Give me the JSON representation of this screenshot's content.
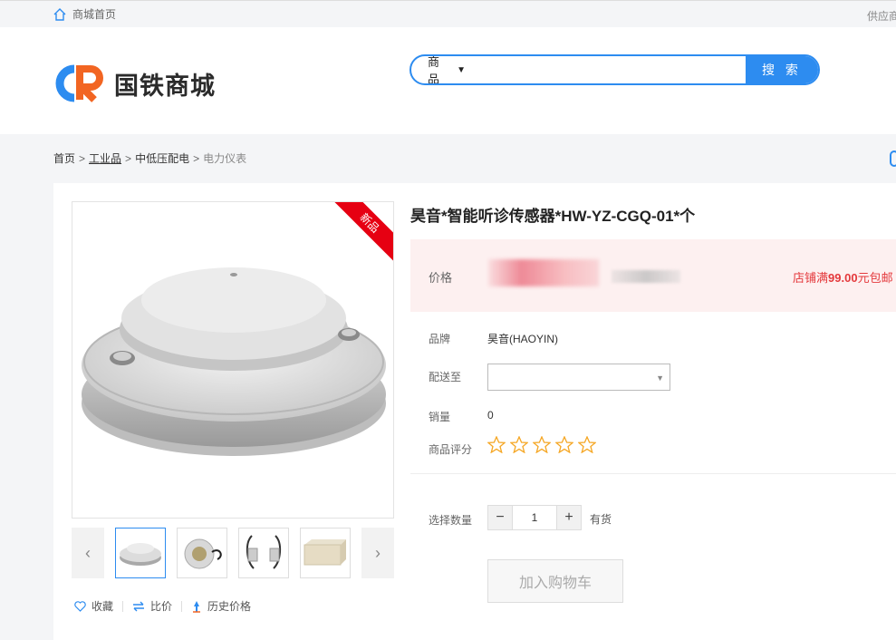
{
  "topbar": {
    "home_label": "商城首页",
    "right_label": "供应商"
  },
  "header": {
    "logo_text": "国铁商城",
    "search": {
      "category": "商品",
      "placeholder": "",
      "button_label": "搜 索"
    }
  },
  "breadcrumb": {
    "items": [
      "首页",
      "工业品",
      "中低压配电",
      "电力仪表"
    ],
    "separator": ">"
  },
  "product": {
    "badge": "新品",
    "title": "昊音*智能听诊传感器*HW-YZ-CGQ-01*个",
    "price_label": "价格",
    "promo_prefix": "店铺满",
    "promo_amount": "99.00",
    "promo_suffix": "元包邮",
    "brand_label": "品牌",
    "brand_value": "昊音(HAOYIN)",
    "ship_label": "配送至",
    "ship_value": "",
    "sales_label": "销量",
    "sales_value": "0",
    "rating_label": "商品评分",
    "rating_value": 0,
    "rating_max": 5,
    "qty_label": "选择数量",
    "qty_value": "1",
    "qty_minus": "−",
    "qty_plus": "+",
    "stock_label": "有货",
    "add_to_cart": "加入购物车"
  },
  "gallery": {
    "prev_icon": "‹",
    "next_icon": "›",
    "thumbnails": [
      "sensor-top",
      "sensor-cable",
      "sensor-side",
      "sensor-box"
    ]
  },
  "actions": {
    "favorite": "收藏",
    "compare": "比价",
    "history": "历史价格"
  },
  "colors": {
    "accent": "#2d8cf0",
    "sale": "#e4393c",
    "badge": "#e60012",
    "star": "#f5a623"
  }
}
